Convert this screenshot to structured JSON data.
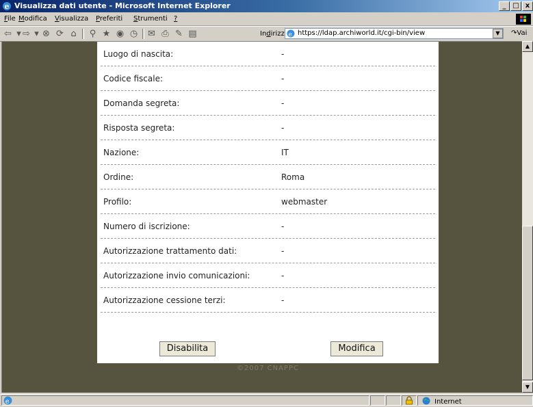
{
  "window": {
    "title": "Visualizza dati utente - Microsoft Internet Explorer",
    "min": "_",
    "max": "□",
    "close": "x"
  },
  "menu": [
    {
      "text": "File",
      "u": "F",
      "rest": "ile"
    },
    {
      "text": "Modifica",
      "u": "M",
      "rest": "odifica"
    },
    {
      "text": "Visualizza",
      "u": "V",
      "rest": "isualizza"
    },
    {
      "text": "Preferiti",
      "u": "P",
      "rest": "referiti"
    },
    {
      "text": "Strumenti",
      "u": "S",
      "rest": "trumenti"
    },
    {
      "text": "?",
      "u": "?",
      "rest": ""
    }
  ],
  "address": {
    "label_pre": "In",
    "label_u": "d",
    "label_post": "irizzo",
    "url": "https://ldap.archiworld.it/cgi-bin/view",
    "go_label": "Vai"
  },
  "fields": [
    {
      "label": "Luogo di nascita:",
      "value": "-"
    },
    {
      "label": "Codice fiscale:",
      "value": "-"
    },
    {
      "label": "Domanda segreta:",
      "value": "-"
    },
    {
      "label": "Risposta segreta:",
      "value": "-"
    },
    {
      "label": "Nazione:",
      "value": "IT"
    },
    {
      "label": "Ordine:",
      "value": "Roma"
    },
    {
      "label": "Profilo:",
      "value": "webmaster"
    },
    {
      "label": "Numero di iscrizione:",
      "value": "-"
    },
    {
      "label": "Autorizzazione trattamento dati:",
      "value": "-"
    },
    {
      "label": "Autorizzazione invio comunicazioni:",
      "value": "-"
    },
    {
      "label": "Autorizzazione cessione terzi:",
      "value": "-"
    }
  ],
  "buttons": {
    "disable": "Disabilita",
    "edit": "Modifica"
  },
  "footer": {
    "copyright": "©2007 CNAPPC"
  },
  "status": {
    "zone": "Internet"
  },
  "colors": {
    "page_bg": "#56543f",
    "panel_bg": "#ffffff",
    "titlebar": "#0a246a"
  }
}
